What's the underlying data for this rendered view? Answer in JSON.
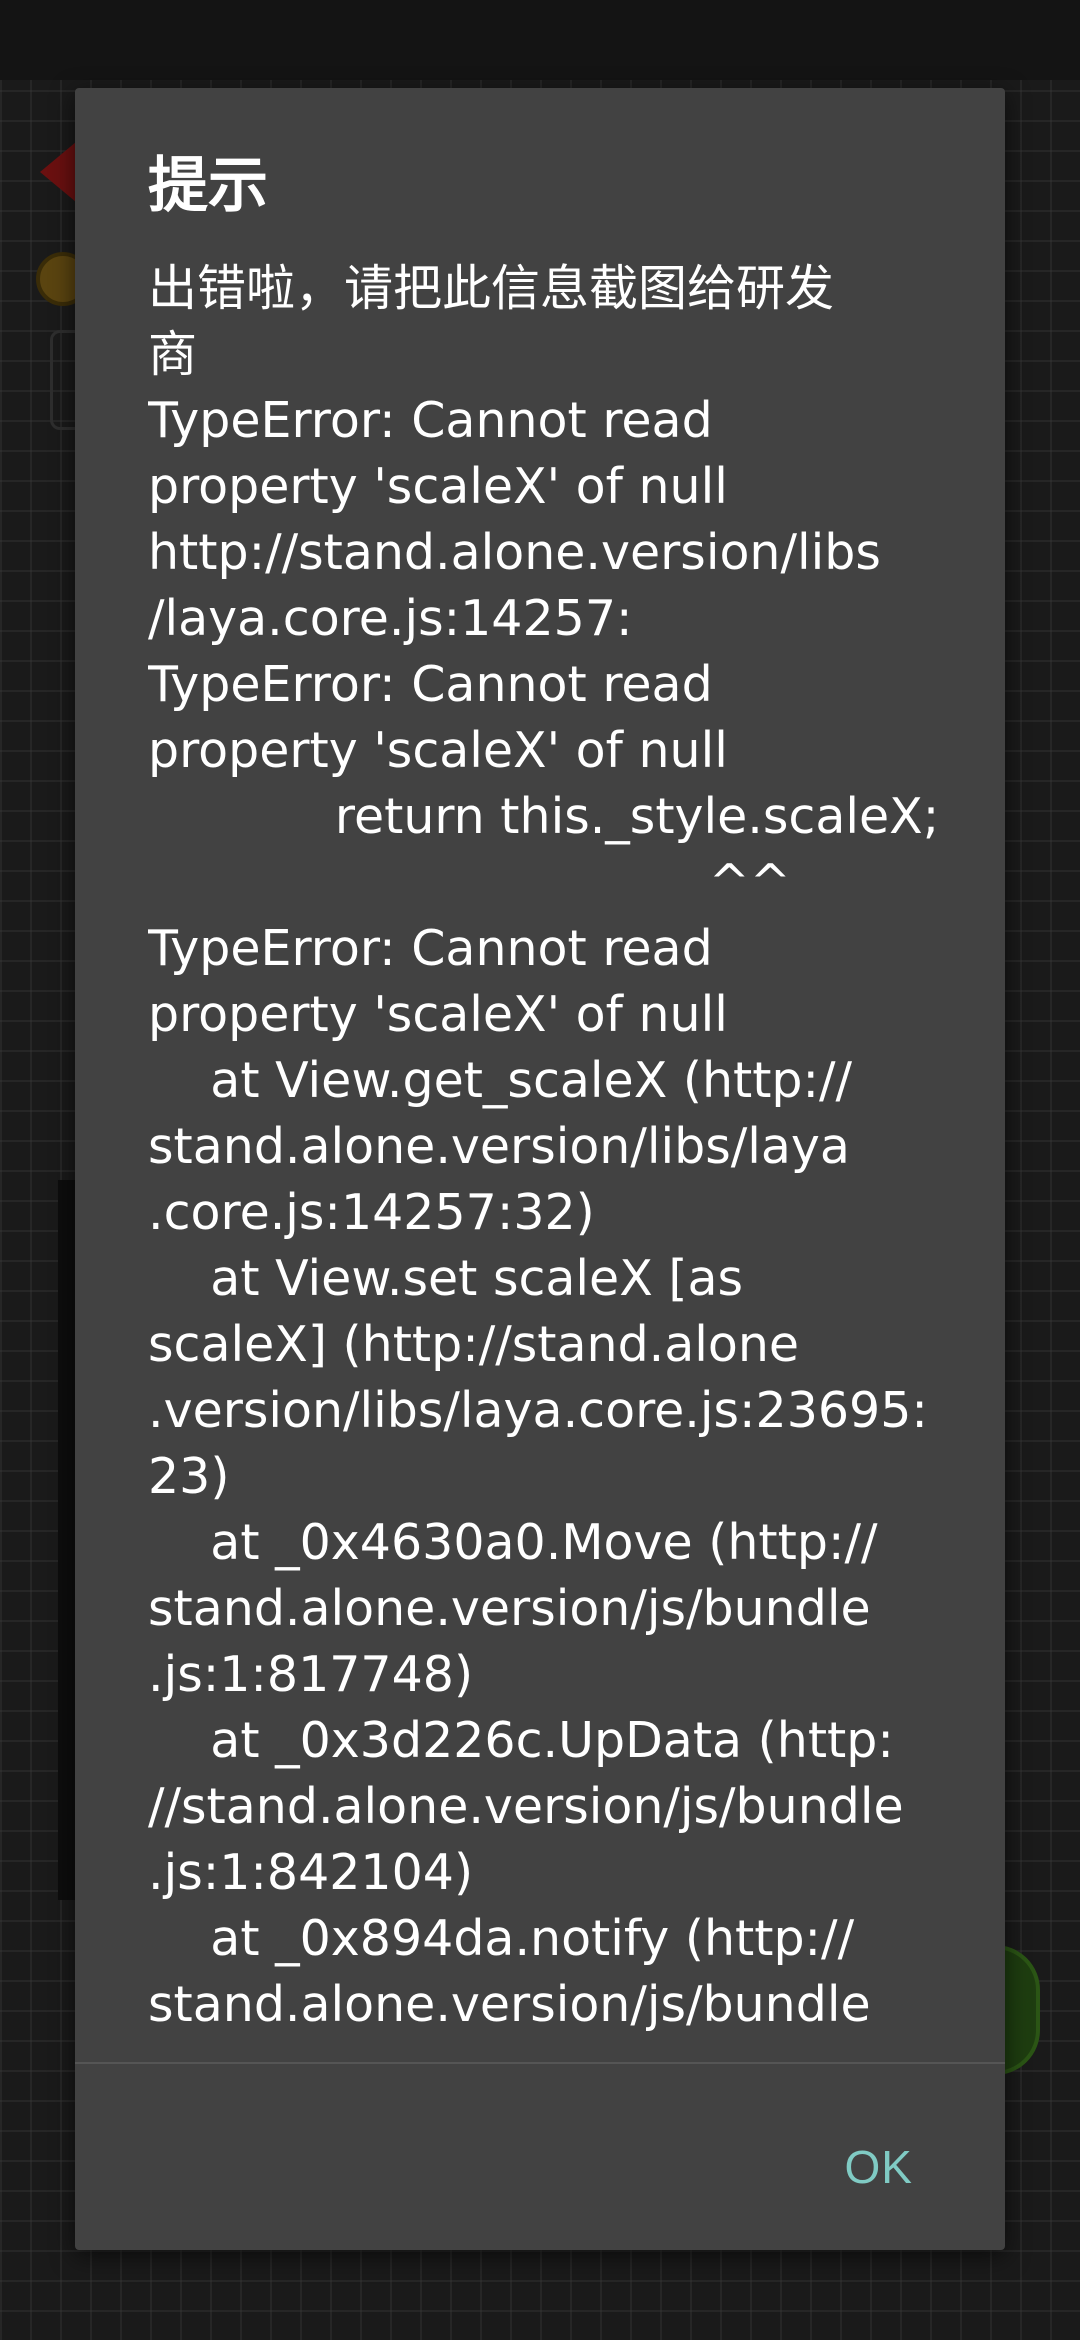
{
  "dialog": {
    "title": "提示",
    "message_lines": [
      "出错啦，请把此信息截图给研发",
      "商",
      "TypeError: Cannot read",
      "property 'scaleX' of null",
      "http://stand.alone.version/libs",
      "/laya.core.js:14257:",
      "TypeError: Cannot read",
      "property 'scaleX' of null",
      "            return this._style.scaleX;",
      "                                    ^^",
      "TypeError: Cannot read",
      "property 'scaleX' of null",
      "    at View.get_scaleX (http://",
      "stand.alone.version/libs/laya",
      ".core.js:14257:32)",
      "    at View.set scaleX [as",
      "scaleX] (http://stand.alone",
      ".version/libs/laya.core.js:23695:",
      "23)",
      "    at _0x4630a0.Move (http://",
      "stand.alone.version/js/bundle",
      ".js:1:817748)",
      "    at _0x3d226c.UpData (http:",
      "//stand.alone.version/js/bundle",
      ".js:1:842104)",
      "    at _0x894da.notify (http://",
      "stand.alone.version/js/bundle"
    ],
    "ok_label": "OK"
  },
  "colors": {
    "dialog_background": "#424242",
    "text": "#ffffff",
    "ok_button": "#80cbc4",
    "scrim_background": "#121212"
  }
}
